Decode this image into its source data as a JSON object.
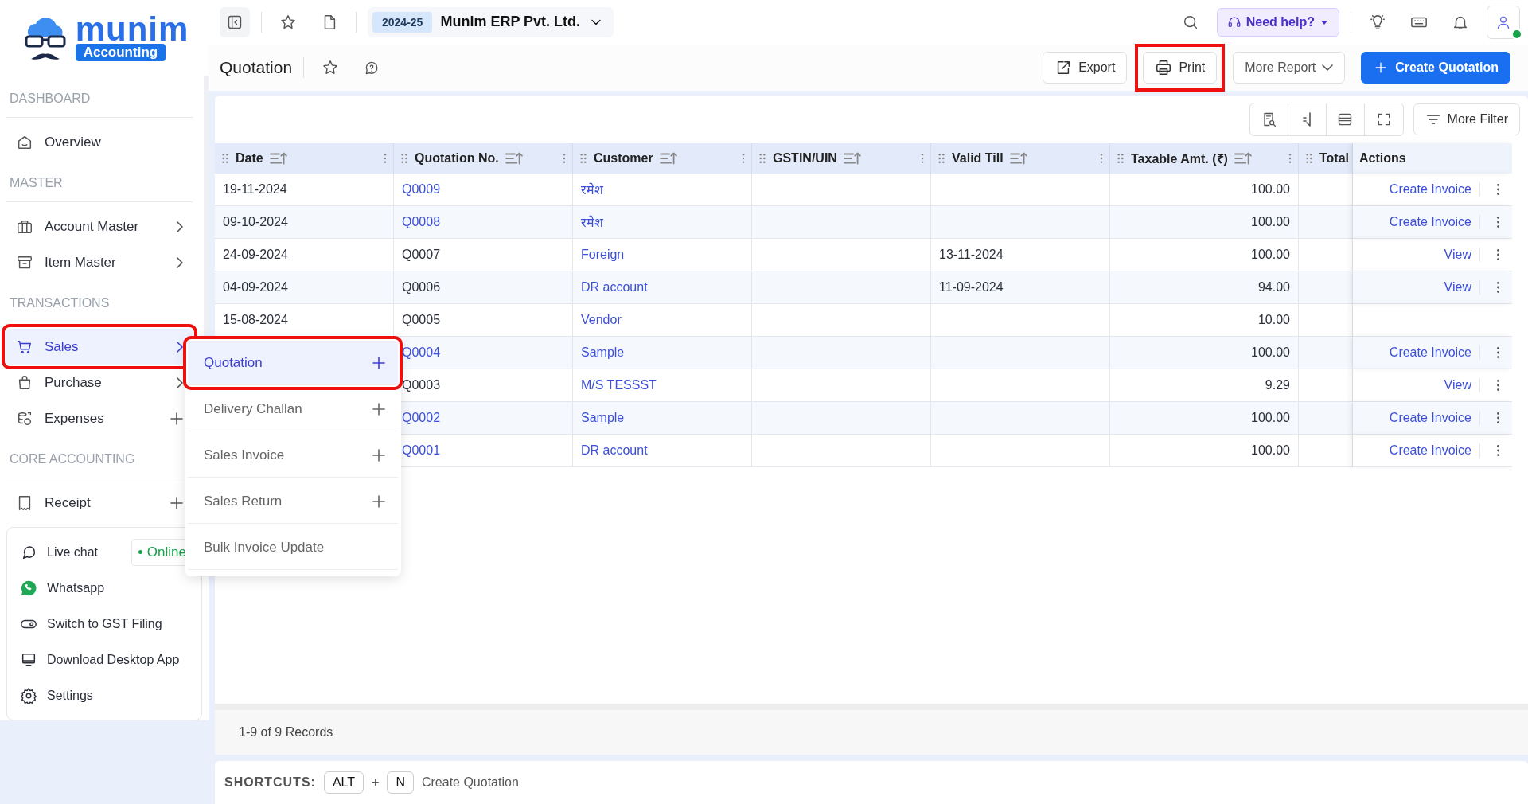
{
  "logo": {
    "name": "munim",
    "tag": "Accounting"
  },
  "topbar": {
    "year": "2024-25",
    "company": "Munim ERP Pvt. Ltd.",
    "help": "Need help?"
  },
  "page": {
    "title": "Quotation",
    "buttons": [
      {
        "label": "Export",
        "kind": "export",
        "highlighted": false
      },
      {
        "label": "Print",
        "kind": "print",
        "highlighted": true
      },
      {
        "label": "More Report",
        "kind": "dropdown",
        "highlighted": false
      },
      {
        "label": "Create Quotation",
        "kind": "primary",
        "highlighted": false
      }
    ]
  },
  "sidebar": {
    "sections": [
      {
        "title": "DASHBOARD",
        "items": [
          {
            "label": "Overview",
            "kind": "plain",
            "selected": false,
            "highlighted": false
          }
        ]
      },
      {
        "title": "MASTER",
        "items": [
          {
            "label": "Account Master",
            "kind": "group",
            "selected": false,
            "highlighted": false
          },
          {
            "label": "Item Master",
            "kind": "group",
            "selected": false,
            "highlighted": false
          }
        ]
      },
      {
        "title": "TRANSACTIONS",
        "items": [
          {
            "label": "Sales",
            "kind": "group",
            "selected": true,
            "highlighted": true
          },
          {
            "label": "Purchase",
            "kind": "group",
            "selected": false,
            "highlighted": false
          },
          {
            "label": "Expenses",
            "kind": "addable",
            "selected": false,
            "highlighted": false
          }
        ]
      },
      {
        "title": "CORE ACCOUNTING",
        "items": [
          {
            "label": "Receipt",
            "kind": "addable",
            "selected": false,
            "highlighted": false
          }
        ]
      }
    ],
    "help_items": [
      {
        "label": "Live chat",
        "badge": "Online"
      },
      {
        "label": "Whatsapp"
      },
      {
        "label": "Switch to GST Filing"
      },
      {
        "label": "Download Desktop App"
      },
      {
        "label": "Settings"
      }
    ]
  },
  "submenu": [
    {
      "label": "Quotation",
      "kind": "addable",
      "selected": true,
      "highlighted": true
    },
    {
      "label": "Delivery Challan",
      "kind": "addable",
      "selected": false,
      "highlighted": false
    },
    {
      "label": "Sales Invoice",
      "kind": "addable",
      "selected": false,
      "highlighted": false
    },
    {
      "label": "Sales Return",
      "kind": "addable",
      "selected": false,
      "highlighted": false
    },
    {
      "label": "Bulk Invoice Update",
      "kind": "plain",
      "selected": false,
      "highlighted": false
    }
  ],
  "table": {
    "filter_button": "More Filter",
    "columns": [
      {
        "label": "Date"
      },
      {
        "label": "Quotation No."
      },
      {
        "label": "Customer"
      },
      {
        "label": "GSTIN/UIN"
      },
      {
        "label": "Valid Till"
      },
      {
        "label": "Taxable Amt. (₹)"
      },
      {
        "label": "Total"
      }
    ],
    "actions_label": "Actions",
    "rows": [
      {
        "date": "19-11-2024",
        "quotation_no": "Q0009",
        "linked": true,
        "customer": "रमेश",
        "taxable_amt": "100.00",
        "action": "Create Invoice"
      },
      {
        "date": "09-10-2024",
        "quotation_no": "Q0008",
        "linked": true,
        "customer": "रमेश",
        "taxable_amt": "100.00",
        "action": "Create Invoice"
      },
      {
        "date": "24-09-2024",
        "quotation_no": "Q0007",
        "linked": false,
        "customer": "Foreign",
        "valid_till": "13-11-2024",
        "taxable_amt": "100.00",
        "action": "View"
      },
      {
        "date": "04-09-2024",
        "quotation_no": "Q0006",
        "linked": false,
        "customer": "DR account",
        "valid_till": "11-09-2024",
        "taxable_amt": "94.00",
        "action": "View"
      },
      {
        "date": "15-08-2024",
        "quotation_no": "Q0005",
        "linked": false,
        "customer": "Vendor",
        "taxable_amt": "10.00"
      },
      {
        "quotation_no": "Q0004",
        "linked": true,
        "customer": "Sample",
        "taxable_amt": "100.00",
        "action": "Create Invoice"
      },
      {
        "quotation_no": "Q0003",
        "linked": false,
        "customer": "M/S TESSST",
        "taxable_amt": "9.29",
        "action": "View"
      },
      {
        "quotation_no": "Q0002",
        "linked": true,
        "customer": "Sample",
        "taxable_amt": "100.00",
        "action": "Create Invoice"
      },
      {
        "quotation_no": "Q0001",
        "linked": true,
        "customer": "DR account",
        "taxable_amt": "100.00",
        "action": "Create Invoice"
      }
    ],
    "records": "1-9 of 9 Records"
  },
  "shortcuts": {
    "label": "SHORTCUTS:",
    "keys": [
      "ALT",
      "N"
    ],
    "joiner": "+",
    "action": "Create Quotation"
  }
}
